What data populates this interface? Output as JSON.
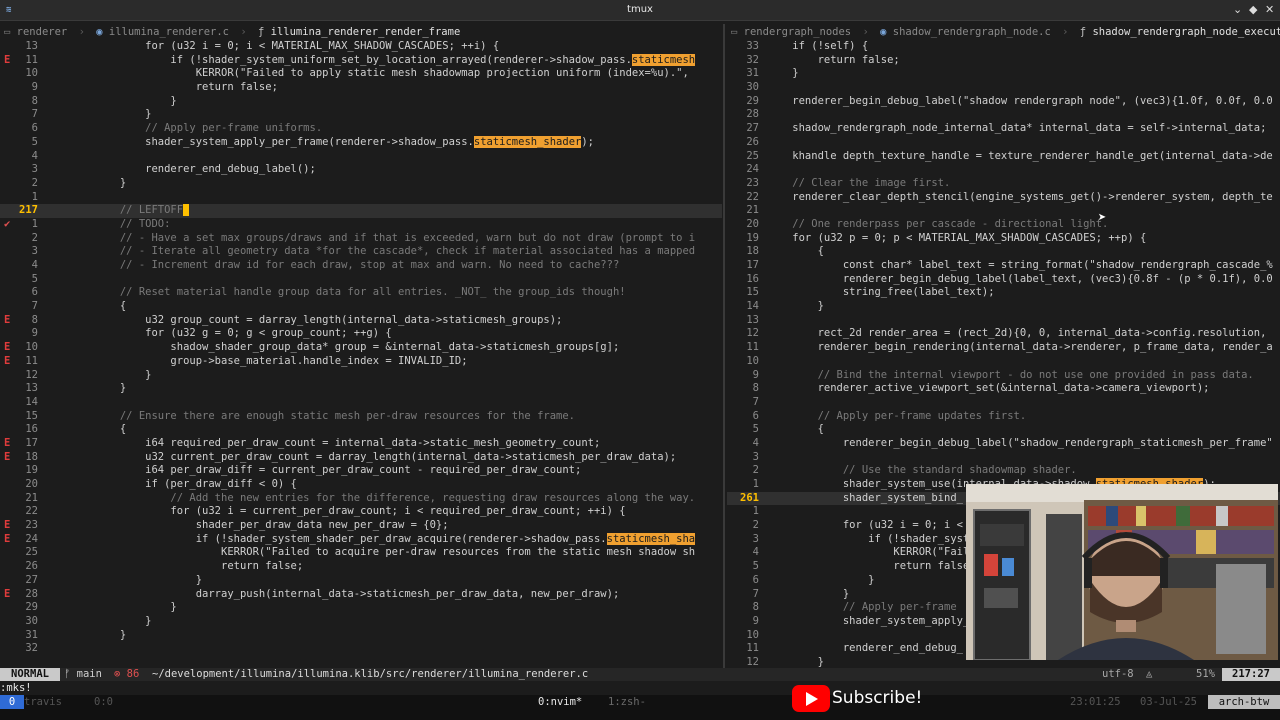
{
  "window": {
    "title": "tmux"
  },
  "left": {
    "breadcrumb": [
      "renderer",
      "illumina_renderer.c",
      "illumina_renderer_render_frame"
    ],
    "lines": [
      {
        "n": "13",
        "s": "",
        "t": "                for (u32 i = 0; i < MATERIAL_MAX_SHADOW_CASCADES; ++i) {"
      },
      {
        "n": "11",
        "s": "E",
        "t": "                    if (!shader_system_uniform_set_by_location_arrayed(renderer->shadow_pass.",
        "h": "staticmesh"
      },
      {
        "n": "10",
        "s": "",
        "t": "                        KERROR(\"Failed to apply static mesh shadowmap projection uniform (index=%u).\","
      },
      {
        "n": "9",
        "s": "",
        "t": "                        return false;"
      },
      {
        "n": "8",
        "s": "",
        "t": "                    }"
      },
      {
        "n": "7",
        "s": "",
        "t": "                }"
      },
      {
        "n": "6",
        "s": "",
        "t": "                // Apply per-frame uniforms."
      },
      {
        "n": "5",
        "s": "",
        "t": "                shader_system_apply_per_frame(renderer->shadow_pass.",
        "h": "staticmesh_shader",
        "a": ");"
      },
      {
        "n": "4",
        "s": "",
        "t": ""
      },
      {
        "n": "3",
        "s": "",
        "t": "                renderer_end_debug_label();"
      },
      {
        "n": "2",
        "s": "",
        "t": "            }"
      },
      {
        "n": "1",
        "s": "",
        "t": ""
      },
      {
        "n": "217",
        "s": "",
        "t": "            // LEFTOFF",
        "cur": true
      },
      {
        "n": "1",
        "s": "✔",
        "t": "            // TODO:"
      },
      {
        "n": "2",
        "s": "",
        "t": "            // - Have a set max groups/draws and if that is exceeded, warn but do not draw (prompt to i"
      },
      {
        "n": "3",
        "s": "",
        "t": "            // - Iterate all geometry data *for the cascade*, check if material associated has a mapped"
      },
      {
        "n": "4",
        "s": "",
        "t": "            // - Increment draw id for each draw, stop at max and warn. No need to cache???"
      },
      {
        "n": "5",
        "s": "",
        "t": ""
      },
      {
        "n": "6",
        "s": "",
        "t": "            // Reset material handle group data for all entries. _NOT_ the group_ids though!"
      },
      {
        "n": "7",
        "s": "",
        "t": "            {"
      },
      {
        "n": "8",
        "s": "E",
        "t": "                u32 group_count = darray_length(internal_data->staticmesh_groups);"
      },
      {
        "n": "9",
        "s": "",
        "t": "                for (u32 g = 0; g < group_count; ++g) {"
      },
      {
        "n": "10",
        "s": "E",
        "t": "                    shadow_shader_group_data* group = &internal_data->staticmesh_groups[g];"
      },
      {
        "n": "11",
        "s": "E",
        "t": "                    group->base_material.handle_index = INVALID_ID;"
      },
      {
        "n": "12",
        "s": "",
        "t": "                }"
      },
      {
        "n": "13",
        "s": "",
        "t": "            }"
      },
      {
        "n": "14",
        "s": "",
        "t": ""
      },
      {
        "n": "15",
        "s": "",
        "t": "            // Ensure there are enough static mesh per-draw resources for the frame."
      },
      {
        "n": "16",
        "s": "",
        "t": "            {"
      },
      {
        "n": "17",
        "s": "E",
        "t": "                i64 required_per_draw_count = internal_data->static_mesh_geometry_count;"
      },
      {
        "n": "18",
        "s": "E",
        "t": "                u32 current_per_draw_count = darray_length(internal_data->staticmesh_per_draw_data);"
      },
      {
        "n": "19",
        "s": "",
        "t": "                i64 per_draw_diff = current_per_draw_count - required_per_draw_count;"
      },
      {
        "n": "20",
        "s": "",
        "t": "                if (per_draw_diff < 0) {"
      },
      {
        "n": "21",
        "s": "",
        "t": "                    // Add the new entries for the difference, requesting draw resources along the way."
      },
      {
        "n": "22",
        "s": "",
        "t": "                    for (u32 i = current_per_draw_count; i < required_per_draw_count; ++i) {"
      },
      {
        "n": "23",
        "s": "E",
        "t": "                        shader_per_draw_data new_per_draw = {0};"
      },
      {
        "n": "24",
        "s": "E",
        "t": "                        if (!shader_system_shader_per_draw_acquire(renderer->shadow_pass.",
        "h": "staticmesh_sha"
      },
      {
        "n": "25",
        "s": "",
        "t": "                            KERROR(\"Failed to acquire per-draw resources from the static mesh shadow sh"
      },
      {
        "n": "26",
        "s": "",
        "t": "                            return false;"
      },
      {
        "n": "27",
        "s": "",
        "t": "                        }"
      },
      {
        "n": "28",
        "s": "E",
        "t": "                        darray_push(internal_data->staticmesh_per_draw_data, new_per_draw);"
      },
      {
        "n": "29",
        "s": "",
        "t": "                    }"
      },
      {
        "n": "30",
        "s": "",
        "t": "                }"
      },
      {
        "n": "31",
        "s": "",
        "t": "            }"
      },
      {
        "n": "32",
        "s": "",
        "t": ""
      }
    ]
  },
  "right": {
    "breadcrumb": [
      "rendergraph_nodes",
      "shadow_rendergraph_node.c",
      "shadow_rendergraph_node_execute"
    ],
    "lines": [
      {
        "n": "33",
        "t": "    if (!self) {"
      },
      {
        "n": "32",
        "t": "        return false;"
      },
      {
        "n": "31",
        "t": "    }"
      },
      {
        "n": "30",
        "t": ""
      },
      {
        "n": "29",
        "t": "    renderer_begin_debug_label(\"shadow rendergraph node\", (vec3){1.0f, 0.0f, 0.0"
      },
      {
        "n": "28",
        "t": ""
      },
      {
        "n": "27",
        "t": "    shadow_rendergraph_node_internal_data* internal_data = self->internal_data;"
      },
      {
        "n": "26",
        "t": ""
      },
      {
        "n": "25",
        "t": "    khandle depth_texture_handle = texture_renderer_handle_get(internal_data->de"
      },
      {
        "n": "24",
        "t": ""
      },
      {
        "n": "23",
        "t": "    // Clear the image first."
      },
      {
        "n": "22",
        "t": "    renderer_clear_depth_stencil(engine_systems_get()->renderer_system, depth_te"
      },
      {
        "n": "21",
        "t": ""
      },
      {
        "n": "20",
        "t": "    // One renderpass per cascade - directional light."
      },
      {
        "n": "19",
        "t": "    for (u32 p = 0; p < MATERIAL_MAX_SHADOW_CASCADES; ++p) {"
      },
      {
        "n": "18",
        "t": "        {"
      },
      {
        "n": "17",
        "t": "            const char* label_text = string_format(\"shadow_rendergraph_cascade_%"
      },
      {
        "n": "16",
        "t": "            renderer_begin_debug_label(label_text, (vec3){0.8f - (p * 0.1f), 0.0"
      },
      {
        "n": "15",
        "t": "            string_free(label_text);"
      },
      {
        "n": "14",
        "t": "        }"
      },
      {
        "n": "13",
        "t": ""
      },
      {
        "n": "12",
        "t": "        rect_2d render_area = (rect_2d){0, 0, internal_data->config.resolution,"
      },
      {
        "n": "11",
        "t": "        renderer_begin_rendering(internal_data->renderer, p_frame_data, render_a"
      },
      {
        "n": "10",
        "t": ""
      },
      {
        "n": "9",
        "t": "        // Bind the internal viewport - do not use one provided in pass data."
      },
      {
        "n": "8",
        "t": "        renderer_active_viewport_set(&internal_data->camera_viewport);"
      },
      {
        "n": "7",
        "t": ""
      },
      {
        "n": "6",
        "t": "        // Apply per-frame updates first."
      },
      {
        "n": "5",
        "t": "        {"
      },
      {
        "n": "4",
        "t": "            renderer_begin_debug_label(\"shadow_rendergraph_staticmesh_per_frame\""
      },
      {
        "n": "3",
        "t": ""
      },
      {
        "n": "2",
        "t": "            // Use the standard shadowmap shader."
      },
      {
        "n": "1",
        "t": "            shader_system_use(internal_data->shadow_",
        "h": "staticmesh_shader",
        "a": ");"
      },
      {
        "n": "261",
        "t": "            shader_system_bind_",
        "cur": true
      },
      {
        "n": "1",
        "t": ""
      },
      {
        "n": "2",
        "t": "            for (u32 i = 0; i <"
      },
      {
        "n": "3",
        "t": "                if (!shader_syst"
      },
      {
        "n": "4",
        "t": "                    KERROR(\"Fail"
      },
      {
        "n": "5",
        "t": "                    return false"
      },
      {
        "n": "6",
        "t": "                }"
      },
      {
        "n": "7",
        "t": "            }"
      },
      {
        "n": "8",
        "t": "            // Apply per-frame"
      },
      {
        "n": "9",
        "t": "            shader_system_apply_"
      },
      {
        "n": "10",
        "t": ""
      },
      {
        "n": "11",
        "t": "            renderer_end_debug_"
      },
      {
        "n": "12",
        "t": "        }"
      }
    ]
  },
  "statusline": {
    "mode": "NORMAL",
    "branch": "main",
    "diagnostics": "86",
    "path": "~/development/illumina/illumina.klib/src/renderer/illumina_renderer.c",
    "encoding": "utf-8",
    "percent": "51%",
    "position": "217:27"
  },
  "cmdline": ":mks!",
  "tmux": {
    "session": "0",
    "session_name": "travis",
    "session_extra": "0:0",
    "window0": "0:nvim*",
    "window1": "1:zsh-",
    "time": "23:01:25",
    "date": "03-Jul-25",
    "host": "arch-btw"
  },
  "overlay": {
    "subscribe_label": "Subscribe!"
  },
  "colors": {
    "mode_bg": "#c9c9c9",
    "highlight": "#f0a030",
    "cursorline_nr": "#ffc000",
    "error_sign": "#e03c3c",
    "session_bg": "#2f6bd6",
    "yt_red": "#ff0000"
  }
}
